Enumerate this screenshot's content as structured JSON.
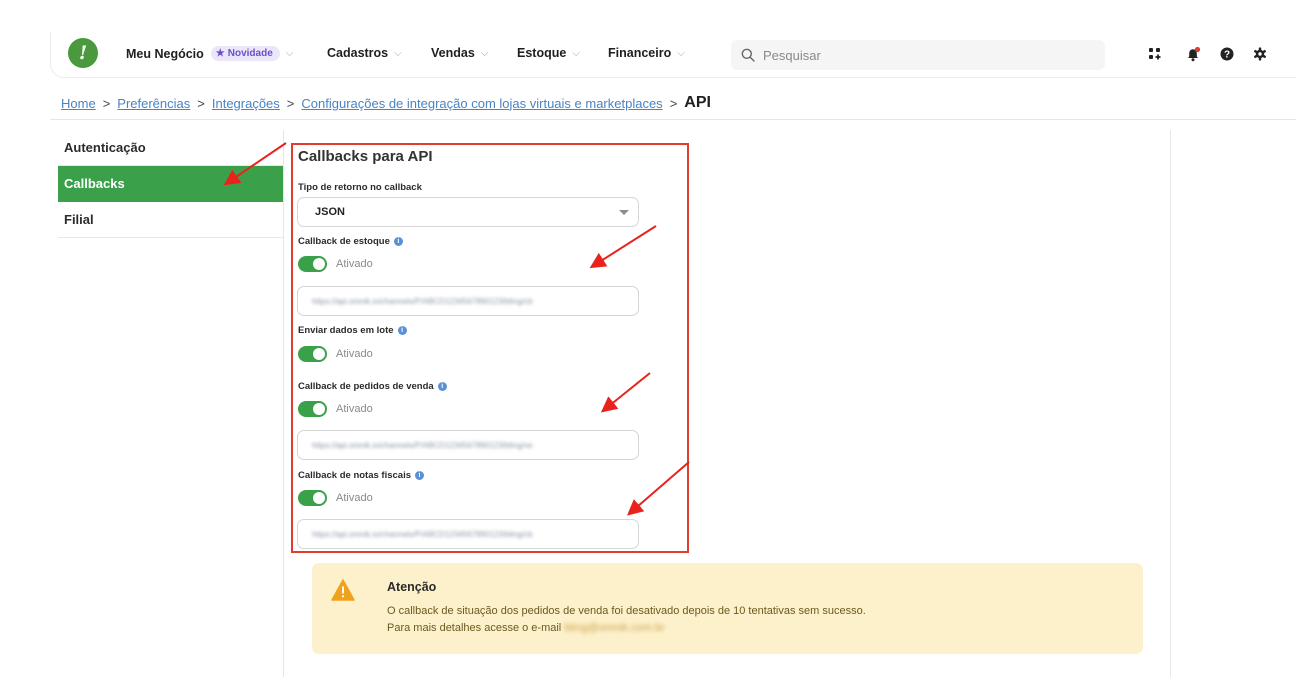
{
  "topbar": {
    "logo": "!",
    "nav": [
      {
        "label": "Meu Negócio",
        "badge": "Novidade"
      },
      {
        "label": "Cadastros"
      },
      {
        "label": "Vendas"
      },
      {
        "label": "Estoque"
      },
      {
        "label": "Financeiro"
      }
    ],
    "search_placeholder": "Pesquisar",
    "icons": [
      "apps-grid-icon",
      "bell-icon",
      "help-icon",
      "gear-icon"
    ]
  },
  "breadcrumb": {
    "items": [
      "Home",
      "Preferências",
      "Integrações",
      "Configurações de integração com lojas virtuais e marketplaces"
    ],
    "current": "API"
  },
  "sidebar": {
    "items": [
      {
        "label": "Autenticação",
        "active": false
      },
      {
        "label": "Callbacks",
        "active": true
      },
      {
        "label": "Filial",
        "active": false
      }
    ]
  },
  "form": {
    "title": "Callbacks para API",
    "return_type": {
      "label": "Tipo de retorno no callback",
      "value": "JSON"
    },
    "stock": {
      "label": "Callback de estoque",
      "toggle": "Ativado",
      "url": "https://api.omnik.io/channels/P/ABCD1234567890123/bling/cb"
    },
    "batch": {
      "label": "Enviar dados em lote",
      "toggle": "Ativado"
    },
    "orders": {
      "label": "Callback de pedidos de venda",
      "toggle": "Ativado",
      "url": "https://api.omnik.io/channels/P/ABCD1234567890123/bling/ve"
    },
    "invoices": {
      "label": "Callback de notas fiscais",
      "toggle": "Ativado",
      "url": "https://api.omnik.io/channels/P/ABCD1234567890123/bling/cb"
    }
  },
  "warning": {
    "title": "Atenção",
    "line1": "O callback de situação dos pedidos de venda foi desativado depois de 10 tentativas sem sucesso.",
    "line2_prefix": "Para mais detalhes acesse o e-mail",
    "email": "bling@omnik.com.br"
  },
  "colors": {
    "accent_green": "#3aa14a",
    "highlight_red": "#e03c2f",
    "link_blue": "#4a83c4",
    "warning_bg": "#fdf1cc"
  }
}
